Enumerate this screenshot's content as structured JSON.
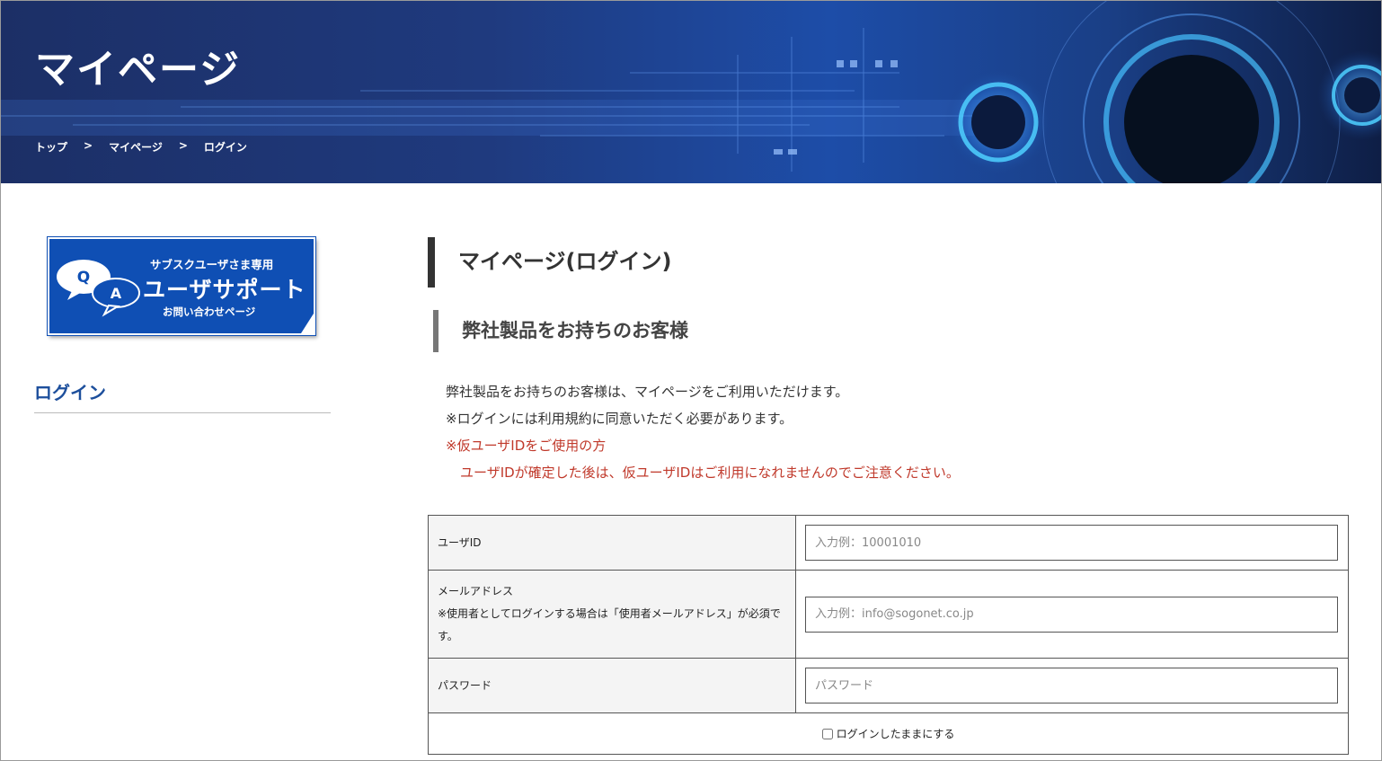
{
  "hero": {
    "title": "マイページ",
    "breadcrumb": [
      "トップ",
      "マイページ",
      "ログイン"
    ],
    "breadcrumb_separator": ">"
  },
  "sidebar": {
    "banner": {
      "top": "サブスクユーザさま専用",
      "main": "ユーザサポート",
      "sub": "お問い合わせページ",
      "bubble_q": "Q",
      "bubble_a": "A"
    },
    "nav_login": "ログイン"
  },
  "main": {
    "heading": "マイページ(ログイン)",
    "subheading": "弊社製品をお持ちのお客様",
    "intro": {
      "line1": "弊社製品をお持ちのお客様は、マイページをご利用いただけます。",
      "line2": "※ログインには利用規約に同意いただく必要があります。",
      "notice_title": "※仮ユーザIDをご使用の方",
      "notice_body": "ユーザIDが確定した後は、仮ユーザIDはご利用になれませんのでご注意ください。"
    },
    "form": {
      "user_id_label": "ユーザID",
      "user_id_placeholder": "入力例：10001010",
      "email_label": "メールアドレス",
      "email_note": "※使用者としてログインする場合は「使用者メールアドレス」が必須です。",
      "email_placeholder": "入力例：info@sogonet.co.jp",
      "password_label": "パスワード",
      "password_placeholder": "パスワード",
      "remember_label": "ログインしたままにする"
    }
  },
  "colors": {
    "accent_blue": "#1d4f9c",
    "banner_blue": "#0f4fb4",
    "notice_red": "#c0392b"
  }
}
